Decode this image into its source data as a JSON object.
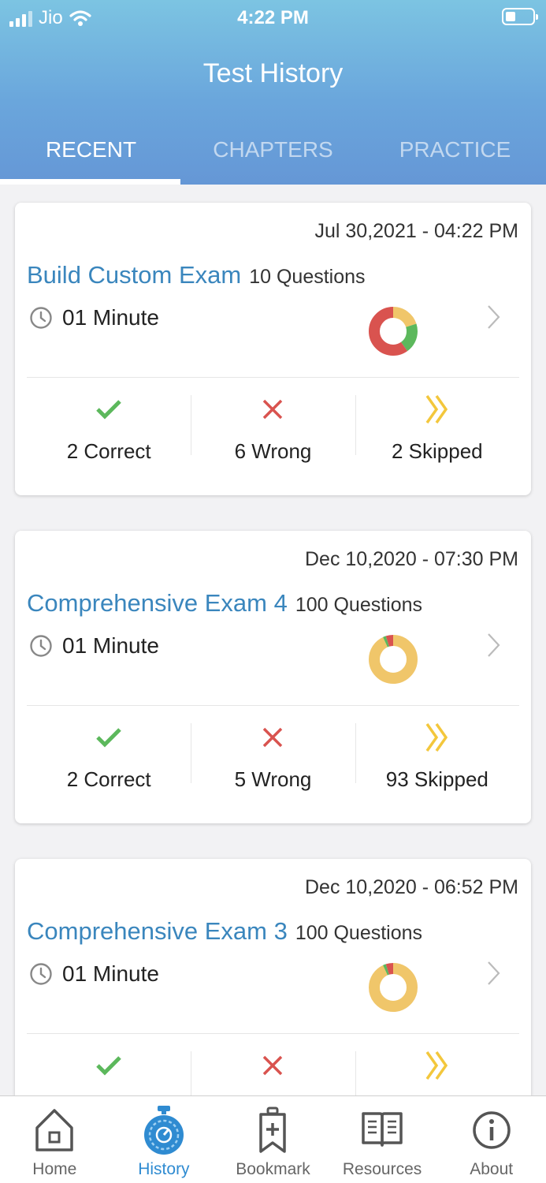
{
  "status_bar": {
    "carrier": "Jio",
    "time": "4:22 PM"
  },
  "header": {
    "title": "Test History"
  },
  "tabs": [
    {
      "label": "RECENT",
      "active": true
    },
    {
      "label": "CHAPTERS",
      "active": false
    },
    {
      "label": "PRACTICE",
      "active": false
    }
  ],
  "colors": {
    "correct": "#5cb85c",
    "wrong": "#d9534f",
    "skipped": "#f0c66a",
    "accent": "#3a86bd"
  },
  "tests": [
    {
      "date": "Jul 30,2021 - 04:22 PM",
      "name": "Build Custom Exam",
      "questions": "10 Questions",
      "duration": "01 Minute",
      "correct": 2,
      "wrong": 6,
      "skipped": 2,
      "correct_label": "2 Correct",
      "wrong_label": "6 Wrong",
      "skipped_label": "2 Skipped"
    },
    {
      "date": "Dec 10,2020 - 07:30 PM",
      "name": "Comprehensive Exam 4",
      "questions": "100 Questions",
      "duration": "01 Minute",
      "correct": 2,
      "wrong": 5,
      "skipped": 93,
      "correct_label": "2 Correct",
      "wrong_label": "5 Wrong",
      "skipped_label": "93 Skipped"
    },
    {
      "date": "Dec 10,2020 - 06:52 PM",
      "name": "Comprehensive Exam 3",
      "questions": "100 Questions",
      "duration": "01 Minute",
      "correct": 2,
      "wrong": 5,
      "skipped": 93,
      "correct_label": "",
      "wrong_label": "",
      "skipped_label": ""
    }
  ],
  "bottom_nav": [
    {
      "label": "Home",
      "icon": "home-icon",
      "active": false
    },
    {
      "label": "History",
      "icon": "stopwatch-icon",
      "active": true
    },
    {
      "label": "Bookmark",
      "icon": "bookmark-icon",
      "active": false
    },
    {
      "label": "Resources",
      "icon": "book-icon",
      "active": false
    },
    {
      "label": "About",
      "icon": "info-icon",
      "active": false
    }
  ]
}
